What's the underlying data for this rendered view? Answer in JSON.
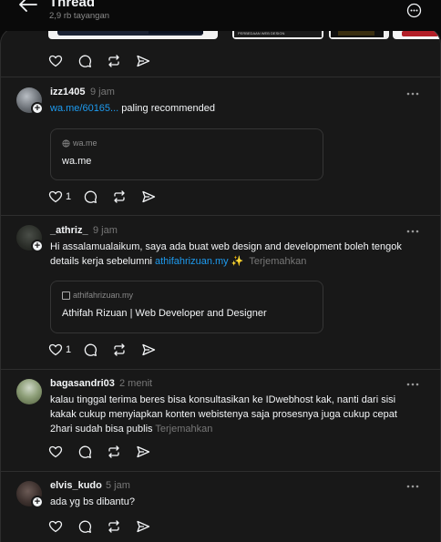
{
  "header": {
    "title": "Thread",
    "views": "2,9 rb tayangan"
  },
  "top_thumbnail_caption": "PERBEDAAN WEB DESIGN",
  "posts": [
    {
      "username": "izz1405",
      "time": "9 jam",
      "text_link": "wa.me/60165...",
      "text_after": " paling recommended",
      "card": {
        "domain": "wa.me",
        "title": "wa.me"
      },
      "likes": "1"
    },
    {
      "username": "_athriz_",
      "time": "9 jam",
      "text_before": "Hi assalamualaikum, saya ada buat web design and development boleh tengok details kerja sebelumni ",
      "text_link": "athifahrizuan.my",
      "text_after": " ✨",
      "translate": "Terjemahkan",
      "card": {
        "domain": "athifahrizuan.my",
        "title": "Athifah Rizuan | Web Developer and Designer"
      },
      "likes": "1"
    },
    {
      "username": "bagasandri03",
      "time": "2 menit",
      "text": "kalau tinggal terima beres bisa konsultasikan ke IDwebhost kak, nanti dari sisi kakak cukup menyiapkan konten webistenya saja prosesnya juga cukup cepat 2hari sudah bisa publis ",
      "translate": "Terjemahkan"
    },
    {
      "username": "elvis_kudo",
      "time": "5 jam",
      "text": "ada yg bs dibantu?"
    }
  ],
  "colors": {
    "link": "#1d9bf0",
    "panel": "#181818",
    "background": "#0a0a0a"
  }
}
